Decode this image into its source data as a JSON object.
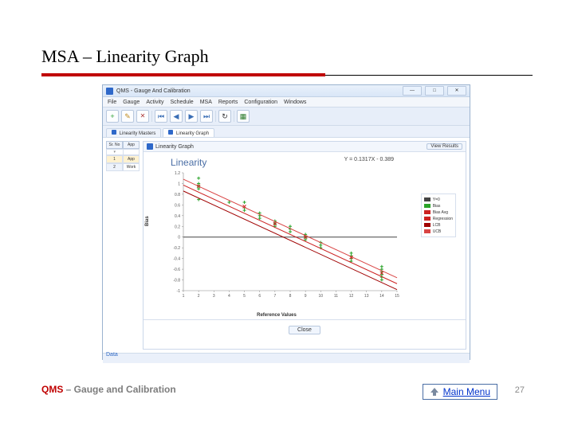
{
  "slide": {
    "title": "MSA – Linearity Graph",
    "footer_brand": "QMS",
    "footer_sub": " – Gauge and Calibration",
    "main_menu_label": "Main Menu",
    "page_number": "27"
  },
  "window": {
    "title": "QMS - Gauge And Calibration",
    "menus": [
      "File",
      "Gauge",
      "Activity",
      "Schedule",
      "MSA",
      "Reports",
      "Configuration",
      "Windows"
    ],
    "tabs": [
      "Linearity Masters",
      "Linearity Graph"
    ],
    "grid_headers": [
      "Sr. No",
      "App"
    ],
    "grid_rows": [
      [
        "1",
        "App"
      ],
      [
        "2",
        "Work"
      ]
    ],
    "panel_title": "Linearity Graph",
    "view_button": "View Results",
    "close_button": "Close",
    "status": "Data"
  },
  "chart_data": {
    "type": "scatter",
    "title": "Linearity",
    "equation": "Y = 0.1317X - 0.389",
    "xlabel": "Reference Values",
    "ylabel": "Bias",
    "xlim": [
      1,
      15
    ],
    "ylim": [
      -1.0,
      1.2
    ],
    "xticks": [
      1,
      2,
      3,
      4,
      5,
      6,
      7,
      8,
      9,
      10,
      11,
      12,
      13,
      14,
      15
    ],
    "yticks": [
      -1.0,
      -0.8,
      -0.6,
      -0.4,
      -0.2,
      0,
      0.2,
      0.4,
      0.6,
      0.8,
      1.0,
      1.2
    ],
    "series": [
      {
        "name": "Y=0",
        "type": "line",
        "color": "#444444",
        "values": [
          [
            1,
            0
          ],
          [
            15,
            0
          ]
        ]
      },
      {
        "name": "Bias",
        "type": "points",
        "color": "#29a329",
        "marker": "plus",
        "values": [
          [
            2,
            0.7
          ],
          [
            2,
            0.9
          ],
          [
            2,
            0.95
          ],
          [
            2,
            1.0
          ],
          [
            2,
            1.1
          ],
          [
            4,
            0.65
          ],
          [
            5,
            0.5
          ],
          [
            5,
            0.55
          ],
          [
            5,
            0.65
          ],
          [
            6,
            0.35
          ],
          [
            6,
            0.4
          ],
          [
            6,
            0.45
          ],
          [
            7,
            0.2
          ],
          [
            7,
            0.25
          ],
          [
            7,
            0.3
          ],
          [
            8,
            0.1
          ],
          [
            8,
            0.15
          ],
          [
            8,
            0.2
          ],
          [
            9,
            0.0
          ],
          [
            9,
            0.05
          ],
          [
            9,
            -0.05
          ],
          [
            10,
            -0.1
          ],
          [
            10,
            -0.15
          ],
          [
            10,
            -0.2
          ],
          [
            12,
            -0.3
          ],
          [
            12,
            -0.35
          ],
          [
            12,
            -0.4
          ],
          [
            12,
            -0.45
          ],
          [
            14,
            -0.55
          ],
          [
            14,
            -0.6
          ],
          [
            14,
            -0.65
          ],
          [
            14,
            -0.7
          ],
          [
            14,
            -0.75
          ],
          [
            14,
            -0.8
          ]
        ]
      },
      {
        "name": "Bias Avg",
        "type": "points",
        "color": "#cc2222",
        "marker": "x",
        "values": [
          [
            2,
            0.95
          ],
          [
            5,
            0.57
          ],
          [
            7,
            0.25
          ],
          [
            9,
            0.0
          ],
          [
            12,
            -0.38
          ],
          [
            14,
            -0.67
          ]
        ]
      },
      {
        "name": "Regression",
        "type": "line",
        "color": "#cc2222",
        "values": [
          [
            1,
            0.97
          ],
          [
            15,
            -0.87
          ]
        ]
      },
      {
        "name": "LCB",
        "type": "line",
        "color": "#a00000",
        "values": [
          [
            1,
            0.86
          ],
          [
            15,
            -0.98
          ]
        ]
      },
      {
        "name": "UCB",
        "type": "line",
        "color": "#d94444",
        "values": [
          [
            1,
            1.08
          ],
          [
            15,
            -0.76
          ]
        ]
      }
    ],
    "legend": [
      "Y=0",
      "Bias",
      "Bias Avg",
      "Regression",
      "LCB",
      "UCB"
    ]
  }
}
